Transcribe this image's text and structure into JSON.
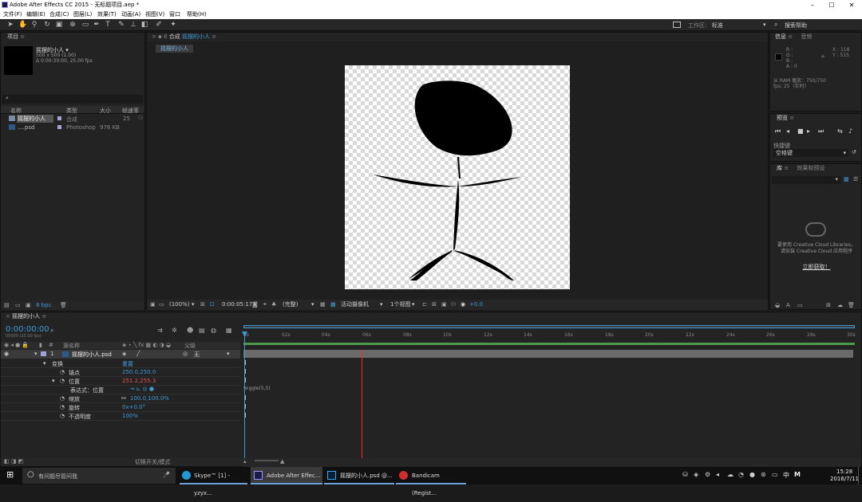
{
  "app": {
    "title": "Adobe After Effects CC 2015 - 无标题项目.aep *"
  },
  "window_controls": {
    "minimize": "–",
    "maximize": "☐",
    "close": "✕"
  },
  "menu": [
    "文件(F)",
    "编辑(E)",
    "合成(C)",
    "图层(L)",
    "效果(T)",
    "动画(A)",
    "视图(V)",
    "窗口",
    "帮助(H)"
  ],
  "toolbar": {
    "workspace_label": "工作区:",
    "workspace_value": "标准",
    "search_help": "搜索帮助"
  },
  "project_panel": {
    "title": "项目",
    "item_name": "摇摆的小人 ▾",
    "item_size": "500 x 500 (1.00)",
    "item_duration": "Δ 0:00:30:00, 25.00 fps",
    "search_icon": "⌕",
    "columns": [
      "名称",
      "类型",
      "大小",
      "帧速率"
    ],
    "rows": [
      {
        "name": "摇摆的小人",
        "type": "合成",
        "size": "",
        "fps": "25"
      },
      {
        "name": "....psd",
        "type": "Photoshop",
        "size": "976 KB",
        "fps": ""
      }
    ],
    "bpc": "8 bpc"
  },
  "composition_panel": {
    "tab_label": "合成",
    "comp_name": "摇摆的小人",
    "breadcrumb": "摇摆的小人",
    "zoom": "(100%)",
    "timecode": "0:00:05:17",
    "resolution": "(完整)",
    "camera": "活动摄像机",
    "views": "1个视图",
    "exposure": "+0.0"
  },
  "info_panel": {
    "tabs": [
      "信息",
      "音频"
    ],
    "r": "R :",
    "g": "G :",
    "b": "B :",
    "a": "A : 0",
    "x": "X : 118",
    "y": "Y : 515",
    "ram": "从 RAM 播放：750/750",
    "fps": "fps: 25（实时）"
  },
  "preview_panel": {
    "title": "预览",
    "shortcut_label": "快捷键",
    "shortcut_value": "空格键"
  },
  "library_panel": {
    "tabs": [
      "库",
      "效果和预设"
    ],
    "message": "要使用 Creative Cloud Libraries，请安装 Creative Cloud 应用程序",
    "link": "立即获取！"
  },
  "timeline": {
    "comp_tab": "摇摆的小人",
    "timecode": "0:00:00:00",
    "timecode_sub": "00000 (25.00 fps)",
    "layer_columns": {
      "source": "源名称",
      "parent": "父级"
    },
    "layer": {
      "index": "1",
      "name": "摇摆的小人.psd",
      "parent": "无"
    },
    "properties": [
      {
        "label": "变换",
        "value": "重置",
        "color": "#3c9ad6"
      },
      {
        "label": "锚点",
        "value": "250.0,250.0",
        "color": "#3c9ad6"
      },
      {
        "label": "位置",
        "value": "251.2,255.3",
        "color": "#e05050"
      },
      {
        "label": "表达式：位置",
        "value": "",
        "color": "#3c9ad6"
      },
      {
        "label": "缩放",
        "value": "100.0,100.0%",
        "color": "#3c9ad6"
      },
      {
        "label": "旋转",
        "value": "0x+0.0°",
        "color": "#3c9ad6"
      },
      {
        "label": "不透明度",
        "value": "100%",
        "color": "#3c9ad6"
      }
    ],
    "expression": "wiggle(5,5)",
    "ruler": [
      "0s",
      "02s",
      "04s",
      "06s",
      "08s",
      "10s",
      "12s",
      "14s",
      "16s",
      "18s",
      "20s",
      "22s",
      "24s",
      "26s",
      "28s",
      "30s"
    ],
    "footer_toggle": "切换开关/模式"
  },
  "taskbar": {
    "search": "有问题尽管问我",
    "items": [
      "Skype™ [1] - yzyx...",
      "Adobe After Effec...",
      "摇摆的小人.psd @...",
      "Bandicam (Regist..."
    ],
    "time": "15:28",
    "date": "2016/7/11",
    "lang": "中"
  },
  "colors": {
    "accent": "#3c9ad6",
    "playhead": "#e03030",
    "work_area": "#4a9a4a"
  }
}
